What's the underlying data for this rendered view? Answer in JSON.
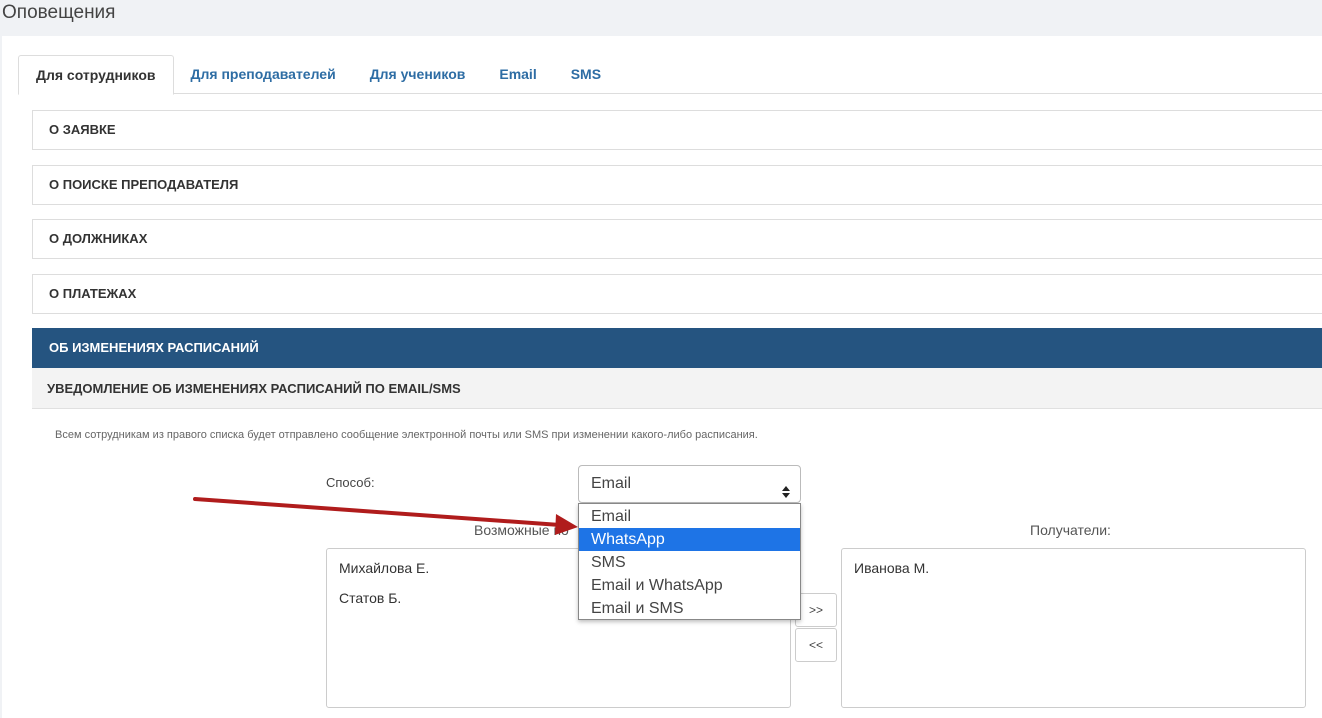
{
  "page": {
    "title": "Оповещения"
  },
  "tabs": [
    {
      "label": "Для сотрудников",
      "active": true
    },
    {
      "label": "Для преподавателей"
    },
    {
      "label": "Для учеников"
    },
    {
      "label": "Email"
    },
    {
      "label": "SMS"
    }
  ],
  "accordion": {
    "items": [
      {
        "label": "О ЗАЯВКЕ"
      },
      {
        "label": "О ПОИСКЕ ПРЕПОДАВАТЕЛЯ"
      },
      {
        "label": "О ДОЛЖНИКАХ"
      },
      {
        "label": "О ПЛАТЕЖАХ"
      },
      {
        "label": "ОБ ИЗМЕНЕНИЯХ РАСПИСАНИЙ",
        "open": true
      }
    ]
  },
  "section": {
    "subheading": "УВЕДОМЛЕНИЕ ОБ ИЗМЕНЕНИЯХ РАСПИСАНИЙ ПО EMAIL/SMS",
    "description": "Всем сотрудникам из правого списка будет отправлено сообщение электронной почты или SMS при изменении какого-либо расписания.",
    "method_label": "Способ:",
    "method_value": "Email",
    "options": [
      {
        "label": "Email"
      },
      {
        "label": "WhatsApp",
        "highlighted": true
      },
      {
        "label": "SMS"
      },
      {
        "label": "Email и WhatsApp"
      },
      {
        "label": "Email и SMS"
      }
    ],
    "available_label": "Возможные по",
    "recipients_label": "Получатели:",
    "available": [
      "Михайлова Е.",
      "Статов Б."
    ],
    "recipients": [
      "Иванова М."
    ],
    "add_button": ">>",
    "remove_button": "<<"
  },
  "colors": {
    "accent": "#255480",
    "link": "#2e6da4",
    "highlight": "#1e74e6",
    "annotation_arrow": "#b01c1c"
  },
  "icons": {
    "select_caret": "up-down-caret-icon"
  }
}
